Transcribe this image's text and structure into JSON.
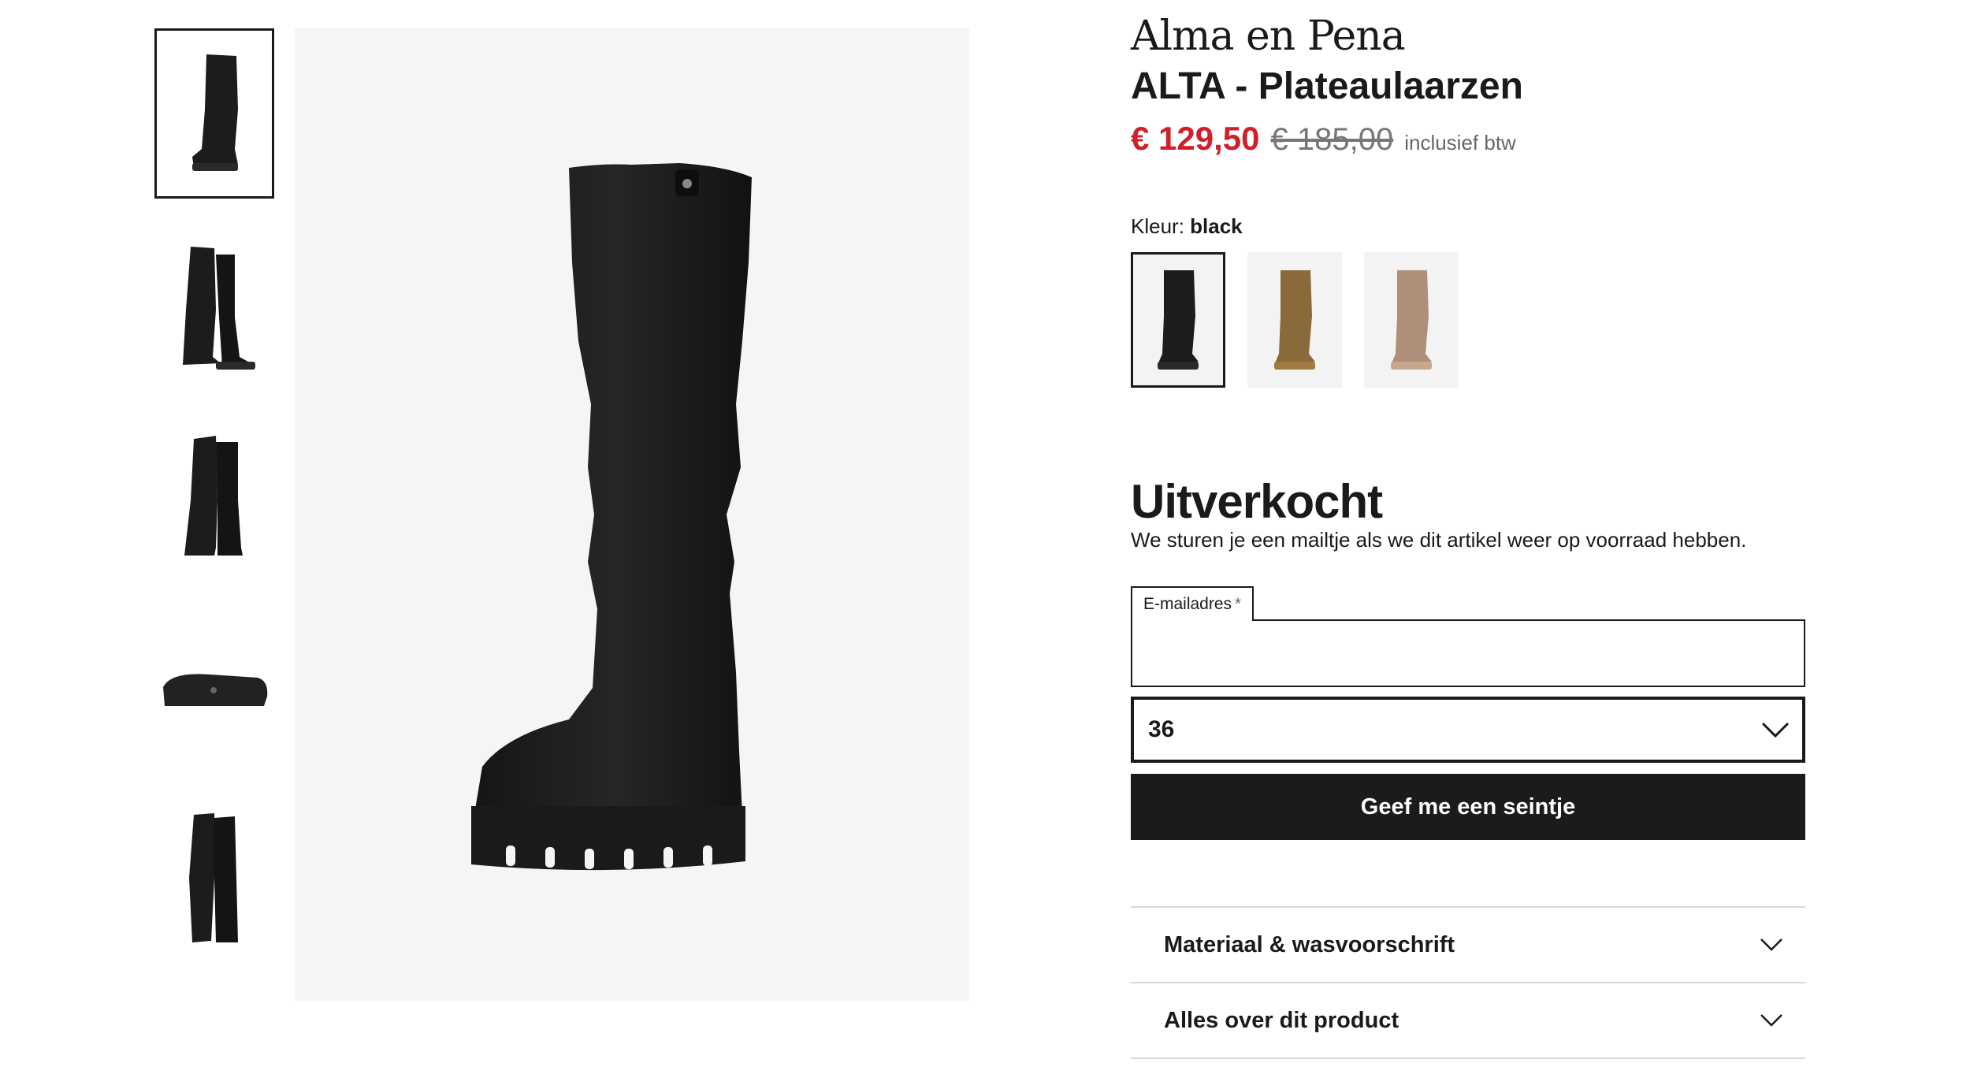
{
  "product": {
    "brand": "Alma en Pena",
    "name": "ALTA - Plateaulaarzen",
    "price_sale": "€ 129,50",
    "price_old": "€ 185,00",
    "price_note": "inclusief btw"
  },
  "color": {
    "label": "Kleur:",
    "selected": "black",
    "swatches": [
      "black",
      "camel",
      "taupe"
    ],
    "colors": {
      "black": "#1c1c1c",
      "camel": "#8a6a3a",
      "taupe": "#b08f7a"
    }
  },
  "gallery": {
    "thumbnails": [
      "side-view",
      "pair-front-view",
      "pair-back-view",
      "sole-view",
      "pair-heel-view"
    ],
    "selected_index": 0
  },
  "stock": {
    "status": "Uitverkocht",
    "message": "We sturen je een mailtje als we dit artikel weer op voorraad hebben."
  },
  "form": {
    "email_label": "E-mailadres",
    "email_required_mark": "*",
    "email_value": "",
    "size_selected": "36",
    "submit_label": "Geef me een seintje"
  },
  "accordion": [
    "Materiaal & wasvoorschrift",
    "Alles over dit product"
  ],
  "icons": {
    "select": "chevron-down-icon",
    "accordion": "chevron-down-icon"
  },
  "theme": {
    "sale_color": "#d0202a",
    "button_color": "#1b1b1b",
    "image_bg": "#f5f5f5"
  }
}
